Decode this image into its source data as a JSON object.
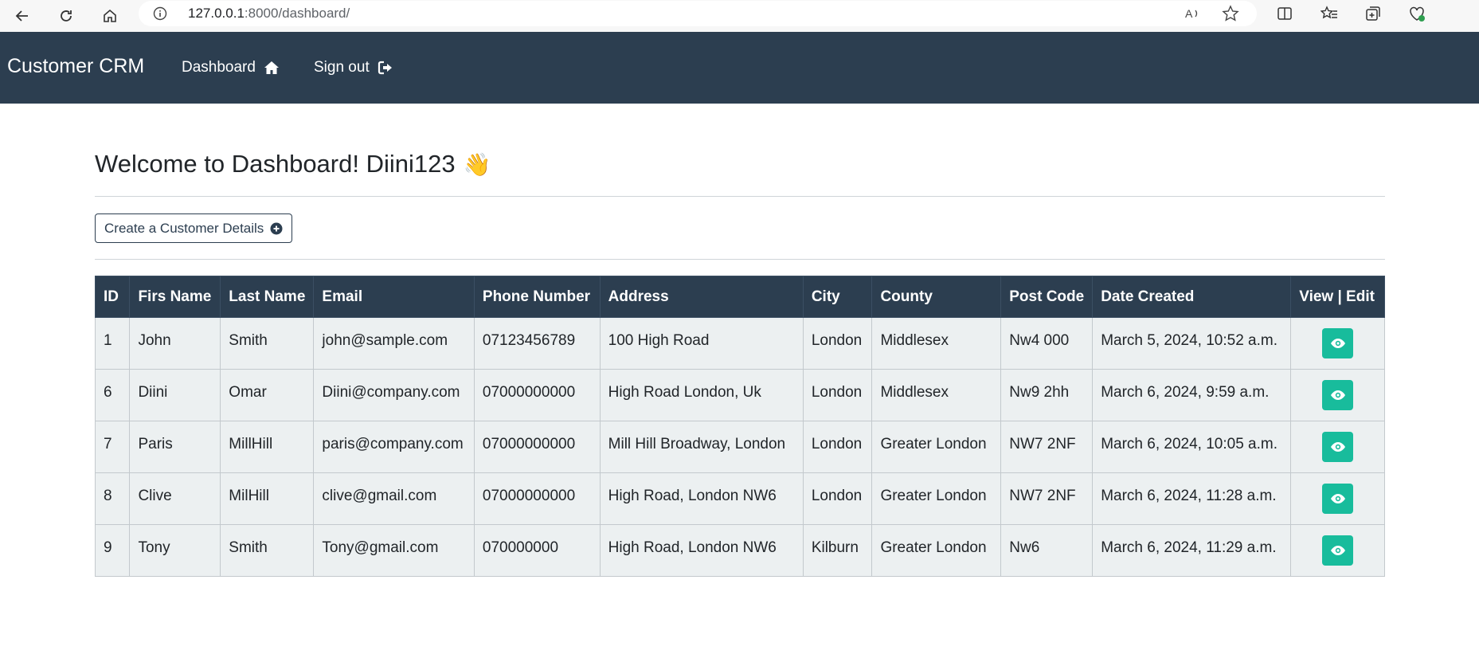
{
  "browser": {
    "url_host": "127.0.0.1",
    "url_rest": ":8000/dashboard/"
  },
  "navbar": {
    "brand": "Customer CRM",
    "dashboard_label": "Dashboard",
    "signout_label": "Sign out"
  },
  "main": {
    "welcome": "Welcome to Dashboard! Diini123",
    "wave": "👋",
    "create_label": "Create a Customer Details"
  },
  "table": {
    "headers": [
      "ID",
      "Firs Name",
      "Last Name",
      "Email",
      "Phone Number",
      "Address",
      "City",
      "County",
      "Post Code",
      "Date Created",
      "View | Edit"
    ],
    "rows": [
      [
        "1",
        "John",
        "Smith",
        "john@sample.com",
        "07123456789",
        "100 High Road",
        "London",
        "Middlesex",
        "Nw4 000",
        "March 5, 2024, 10:52 a.m."
      ],
      [
        "6",
        "Diini",
        "Omar",
        "Diini@company.com",
        "07000000000",
        "High Road London, Uk",
        "London",
        "Middlesex",
        "Nw9 2hh",
        "March 6, 2024, 9:59 a.m."
      ],
      [
        "7",
        "Paris",
        "MillHill",
        "paris@company.com",
        "07000000000",
        "Mill Hill Broadway, London",
        "London",
        "Greater London",
        "NW7 2NF",
        "March 6, 2024, 10:05 a.m."
      ],
      [
        "8",
        "Clive",
        "MilHill",
        "clive@gmail.com",
        "07000000000",
        "High Road, London NW6",
        "London",
        "Greater London",
        "NW7 2NF",
        "March 6, 2024, 11:28 a.m."
      ],
      [
        "9",
        "Tony",
        "Smith",
        "Tony@gmail.com",
        "070000000",
        "High Road, London NW6",
        "Kilburn",
        "Greater London",
        "Nw6",
        "March 6, 2024, 11:29 a.m."
      ]
    ]
  },
  "colors": {
    "navbar": "#2c3e50",
    "row_bg": "#ecf0f1",
    "view_button": "#18bc9c"
  },
  "icons": {
    "dashboard": "home-icon",
    "signout": "sign-out-icon",
    "create": "plus-circle-icon",
    "view": "eye-icon"
  }
}
